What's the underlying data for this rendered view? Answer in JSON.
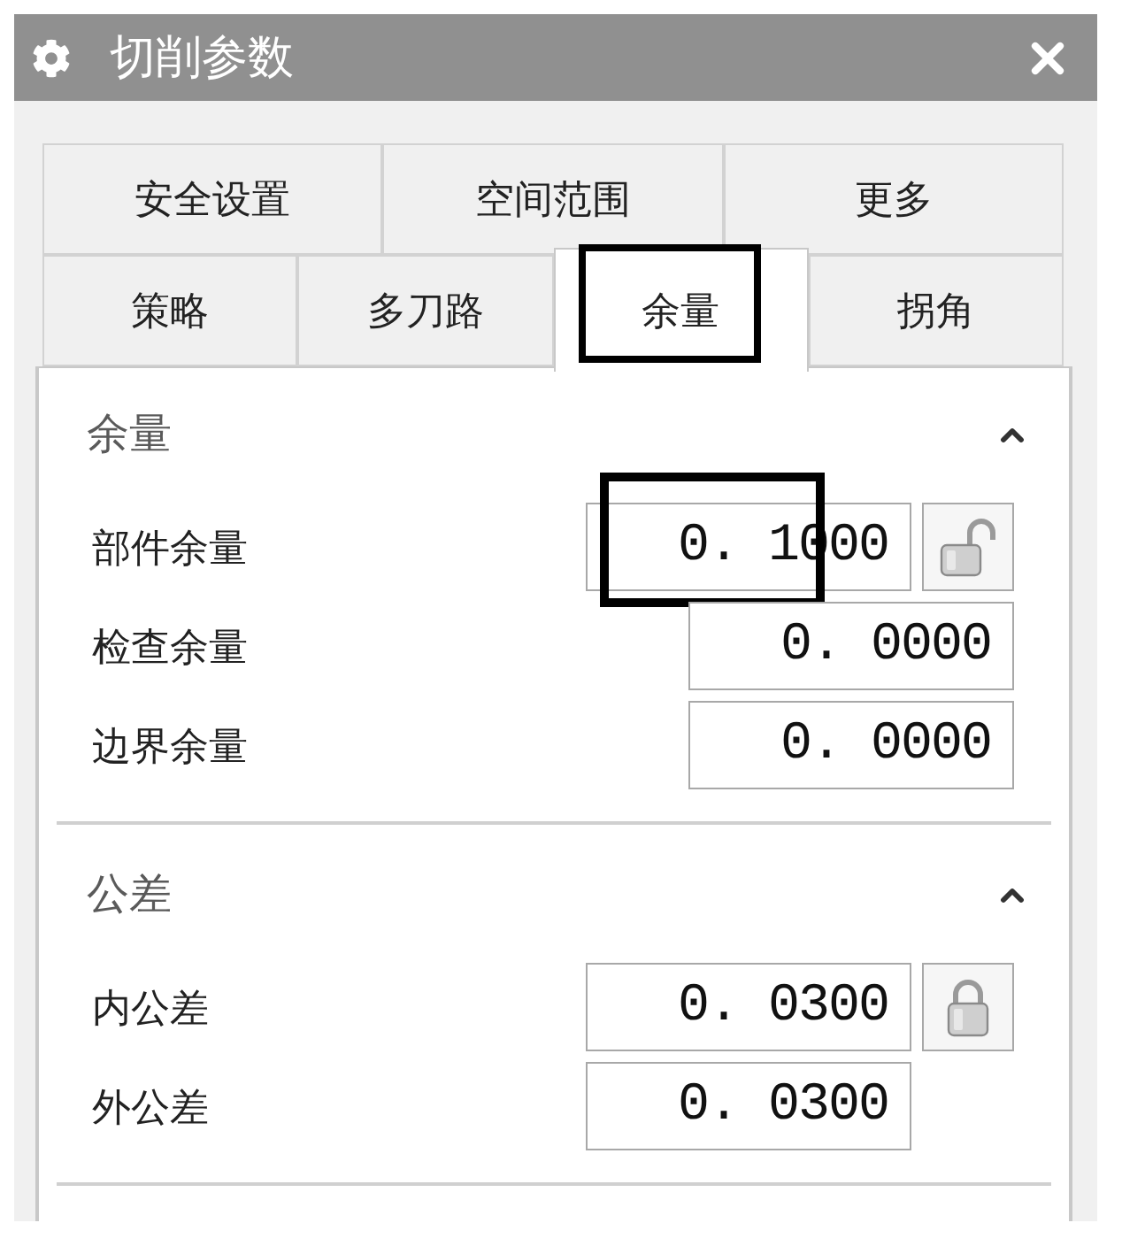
{
  "window": {
    "title": "切削参数"
  },
  "tab_rows": [
    {
      "tabs": [
        {
          "label": "安全设置",
          "selected": false,
          "highlighted": false
        },
        {
          "label": "空间范围",
          "selected": false,
          "highlighted": false
        },
        {
          "label": "更多",
          "selected": false,
          "highlighted": false
        }
      ]
    },
    {
      "tabs": [
        {
          "label": "策略",
          "selected": false,
          "highlighted": false
        },
        {
          "label": "多刀路",
          "selected": false,
          "highlighted": false
        },
        {
          "label": "余量",
          "selected": true,
          "highlighted": true
        },
        {
          "label": "拐角",
          "selected": false,
          "highlighted": false
        }
      ]
    }
  ],
  "sections": [
    {
      "title": "余量",
      "expanded": true,
      "rows": [
        {
          "kind": "with_lock",
          "label": "部件余量",
          "value": "0. 1000",
          "locked": false,
          "highlighted": true
        },
        {
          "kind": "full",
          "label": "检查余量",
          "value": "0. 0000",
          "highlighted": false
        },
        {
          "kind": "full",
          "label": "边界余量",
          "value": "0. 0000",
          "highlighted": false
        }
      ]
    },
    {
      "title": "公差",
      "expanded": true,
      "rows": [
        {
          "kind": "with_lock",
          "label": "内公差",
          "value": "0. 0300",
          "locked": true,
          "highlighted": false
        },
        {
          "kind": "short",
          "label": "外公差",
          "value": "0. 0300",
          "highlighted": false
        }
      ]
    }
  ]
}
